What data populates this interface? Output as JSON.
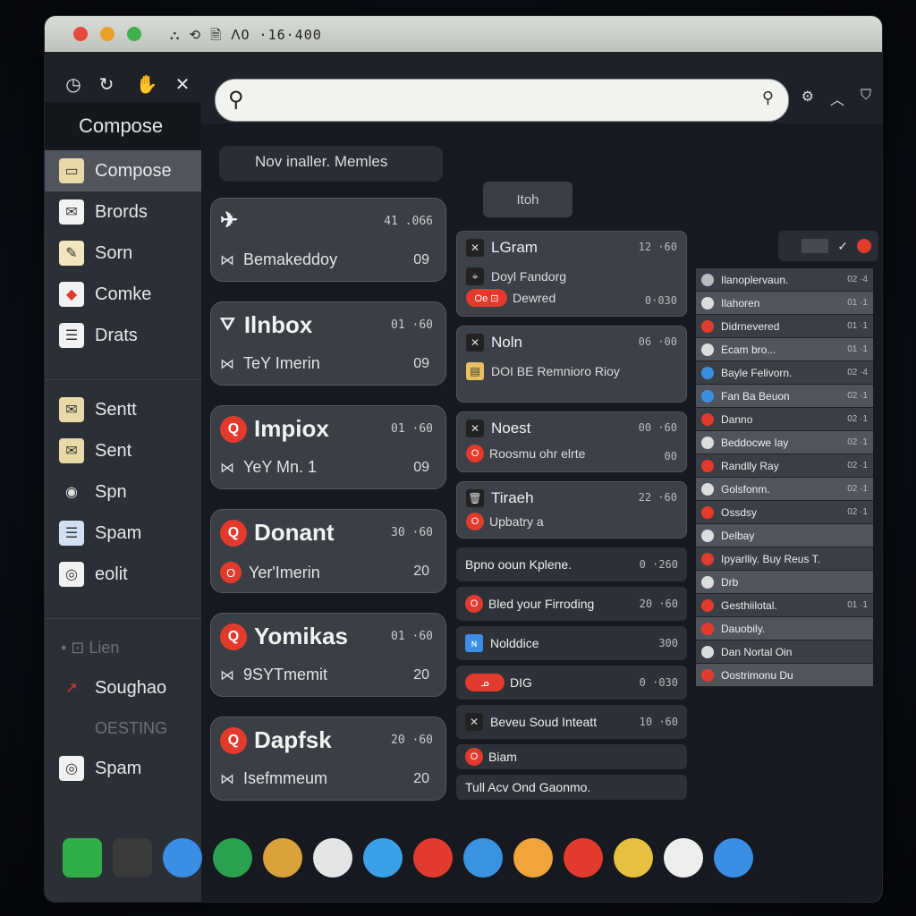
{
  "window": {
    "title_text": "⛬ ⟲ 🗎 ꓥO ·16·400"
  },
  "search": {
    "placeholder": "",
    "value": ""
  },
  "sidebar": {
    "header": "Compose",
    "items": [
      {
        "label": "Compose",
        "icon": "compose-icon",
        "active": true
      },
      {
        "label": "Brords",
        "icon": "inbox-icon"
      },
      {
        "label": "Sorn",
        "icon": "note-icon"
      },
      {
        "label": "Comke",
        "icon": "starred-icon"
      },
      {
        "label": "Drats",
        "icon": "drafts-icon"
      },
      {
        "label": "Sentt",
        "icon": "sent-icon"
      },
      {
        "label": "Sent",
        "icon": "sent-icon"
      },
      {
        "label": "Spn",
        "icon": "eye-icon"
      },
      {
        "label": "Spam",
        "icon": "spam-icon"
      },
      {
        "label": "eolit",
        "icon": "edit-icon"
      }
    ],
    "muted_1": "• ⊡ Lien",
    "item_soughao": "Soughao",
    "muted_2": "OESTING",
    "item_spam2": "Spam"
  },
  "col1": {
    "header": "Nov inaller. Memles",
    "cards": [
      {
        "title": "",
        "time": "41 .066",
        "sub": "Bemakeddoy",
        "num": "09",
        "badge": "",
        "title_icon": "pin-icon"
      },
      {
        "title": "Ilnbox",
        "time": "01 ·60",
        "sub": "TeY Imerin",
        "num": "09",
        "badge": "",
        "title_icon": "inbox-tray-icon"
      },
      {
        "title": "Impiox",
        "time": "01 ·60",
        "sub": "YeY Mn. 1",
        "num": "09",
        "badge": "Q",
        "title_icon": "badge"
      },
      {
        "title": "Donant",
        "time": "30 ·60",
        "sub": "Yer'Imerin",
        "num": "20",
        "badge": "Q",
        "title_icon": "badge",
        "sub_badge": "O"
      },
      {
        "title": "Yomikas",
        "time": "01 ·60",
        "sub": "9SYTmemit",
        "num": "20",
        "badge": "Q",
        "title_icon": "badge"
      },
      {
        "title": "Dapfsk",
        "time": "20 ·60",
        "sub": "Isefmmeum",
        "num": "20",
        "badge": "Q",
        "title_icon": "badge"
      }
    ]
  },
  "col2": {
    "pill": "Itoh",
    "cards": [
      {
        "title": "LGram",
        "time": "12 ·60",
        "line1": "Doyl Fandorg",
        "line2": "Dewred",
        "badge2": "Oe ⊡",
        "num": "0·030"
      },
      {
        "title": "Noln",
        "time": "06 ·00",
        "line1": "DOI BE Remnioro Rioy",
        "num": ""
      },
      {
        "title": "Noest",
        "time": "00 ·60",
        "line1": "Roosmu ohr elrte",
        "num": "00"
      },
      {
        "title": "Tiraeh",
        "time": "22 ·60",
        "line1": "Upbatry a",
        "num": ""
      }
    ],
    "rows": [
      {
        "label": "Bpno ooun Kplene.",
        "time": "0 ·260"
      },
      {
        "label": "Bled your Firroding",
        "time": "20 ·60",
        "badge": "O"
      },
      {
        "label": "Nolddice",
        "time": "300"
      },
      {
        "label": "DIG",
        "time": "0 ·030",
        "badge": "ᓄ"
      },
      {
        "label": "Beveu Soud Inteatt",
        "time": "10 ·60"
      },
      {
        "label": "Biam",
        "time": "",
        "badge": "O"
      },
      {
        "label": "Tull Acv Ond Gaonmo.",
        "time": ""
      }
    ]
  },
  "col3": {
    "rows": [
      {
        "label": "Ilanoplervaun.",
        "time": "02 ·4",
        "color": "#bbb"
      },
      {
        "label": "Ilahoren",
        "time": "01 ·1",
        "color": "#ddd"
      },
      {
        "label": "Didrnevered",
        "time": "01 ·1",
        "color": "#e23b2e"
      },
      {
        "label": "Ecam bro...",
        "time": "01 ·1",
        "color": "#ddd"
      },
      {
        "label": "Bayle Felivorn.",
        "time": "02 ·4",
        "color": "#3b8fe0"
      },
      {
        "label": "Fan Ba Beuon",
        "time": "02 ·1",
        "color": "#3b8fe0"
      },
      {
        "label": "Danno",
        "time": "02 ·1",
        "color": "#e23b2e"
      },
      {
        "label": "Beddocwe Iay",
        "time": "02 ·1",
        "color": "#ddd"
      },
      {
        "label": "Randlly Ray",
        "time": "02 ·1",
        "color": "#e23b2e"
      },
      {
        "label": "Golsfonm.",
        "time": "02 ·1",
        "color": "#ddd"
      },
      {
        "label": "Ossdsy",
        "time": "02 ·1",
        "color": "#e23b2e"
      },
      {
        "label": "Delbay",
        "time": "",
        "color": "#ddd"
      },
      {
        "label": "Ipyarlliy. Buy Reus T.",
        "time": "",
        "color": "#e23b2e"
      },
      {
        "label": "Drb",
        "time": "",
        "color": "#ddd"
      },
      {
        "label": "Gesthiilotal.",
        "time": "01 ·1",
        "color": "#e23b2e"
      },
      {
        "label": "Dauobily.",
        "time": "",
        "color": "#e23b2e"
      },
      {
        "label": "Dan Nortal Oin",
        "time": "",
        "color": "#ddd"
      },
      {
        "label": "Oostrimonu Du",
        "time": "",
        "color": "#e23b2e"
      }
    ]
  },
  "dock_colors": [
    "#2fae4a",
    "#3a3a3a",
    "#3a8ee6",
    "#2aa14e",
    "#d9a23b",
    "#e5e5e5",
    "#3aa0ea",
    "#e23b2e",
    "#3a93e0",
    "#f0a43a",
    "#e23b2e",
    "#e8c040",
    "#eeeeee",
    "#3a8ee6"
  ],
  "accent": "#e23b2e"
}
